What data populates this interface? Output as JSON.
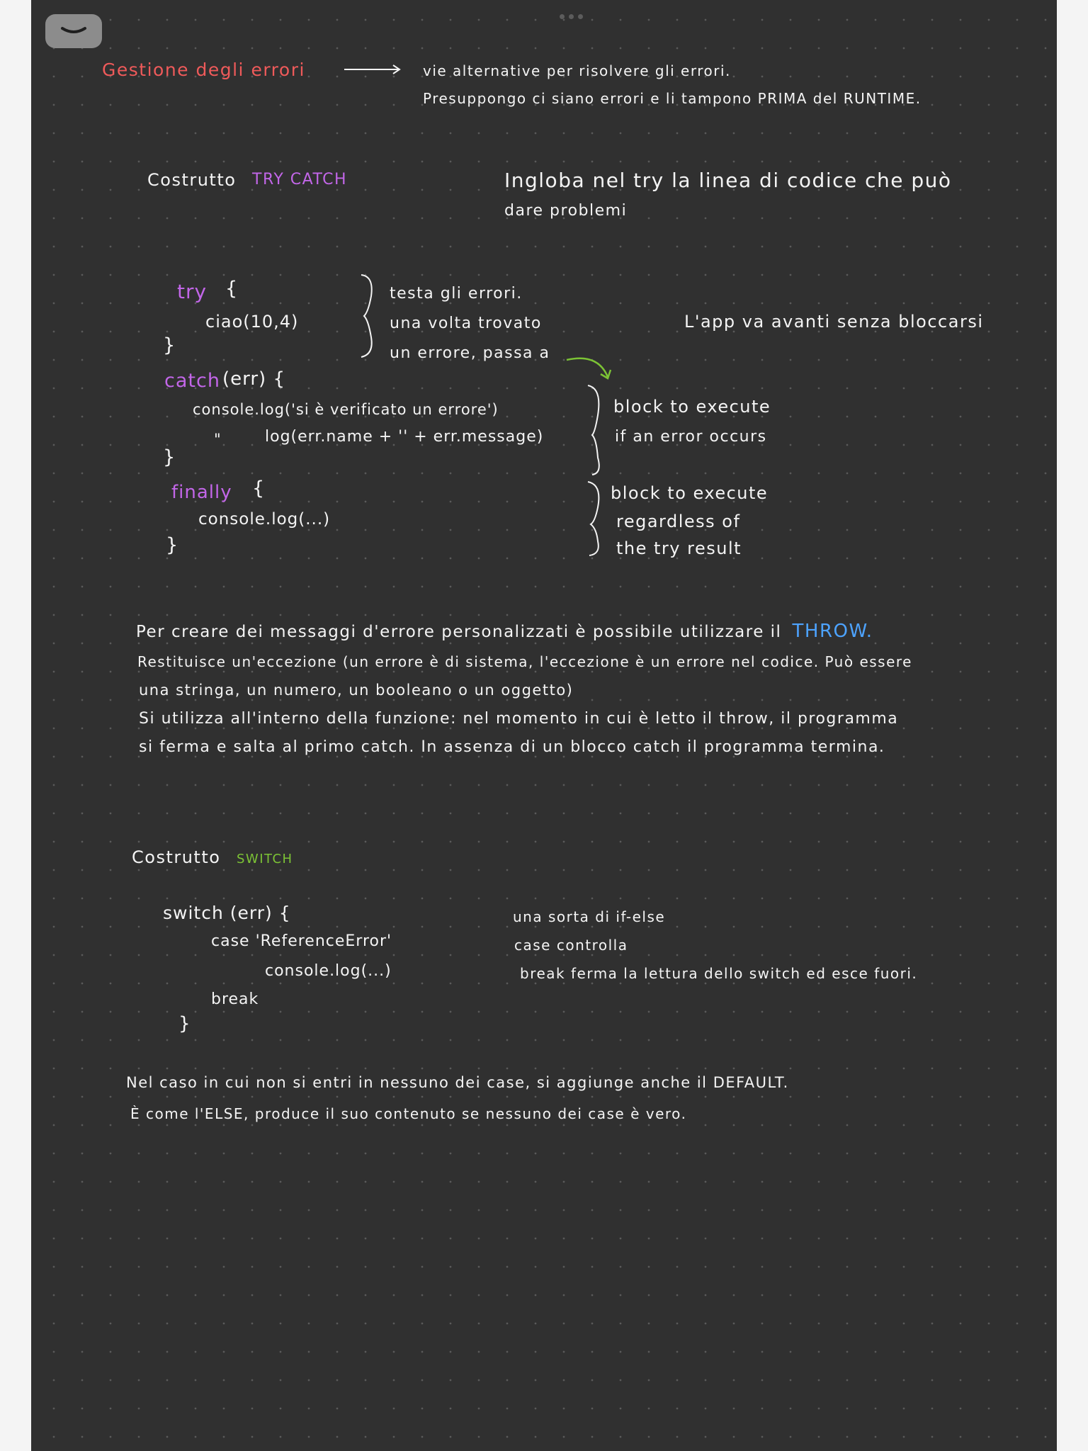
{
  "toolbar": {
    "collapse_icon": "chevron-down-icon"
  },
  "colors": {
    "red": "#ef5a5a",
    "purple": "#c266e8",
    "blue": "#4da3ff",
    "green": "#7cc335",
    "ink": "#f4f4f4",
    "paper": "#303030"
  },
  "section_errors": {
    "title": "Gestione degli errori",
    "desc_line1": "vie alternative per risolvere gli errori.",
    "desc_line2": "Presuppongo ci siano errori e li tampono PRIMA del RUNTIME."
  },
  "section_try": {
    "label": "Costrutto",
    "keyword": "TRY CATCH",
    "note_line1": "Ingloba nel try la linea di codice che può",
    "note_line2": "dare problemi",
    "code": {
      "try_kw": "try",
      "try_brace": "{",
      "try_body": "ciao(10,4)",
      "try_close": "}",
      "catch_kw": "catch",
      "catch_args": "(err) {",
      "catch_body1": "console.log('si è verificato un errore')",
      "catch_body2_prefix": "\"",
      "catch_body2": "log(err.name + '' + err.message)",
      "catch_close": "}",
      "finally_kw": "finally",
      "finally_brace": "{",
      "finally_body": "console.log(...)",
      "finally_close": "}"
    },
    "try_note": [
      "testa gli errori.",
      "una volta trovato",
      "un errore, passa a"
    ],
    "app_note": "L'app va avanti senza bloccarsi",
    "catch_note": [
      "block to execute",
      "if an error occurs"
    ],
    "finally_note": [
      "block to execute",
      "regardless of",
      "the try result"
    ]
  },
  "section_throw": {
    "line1_text": "Per creare dei messaggi d'errore personalizzati è possibile utilizzare il",
    "line1_keyword": "THROW.",
    "line2": "Restituisce un'eccezione (un errore è di sistema, l'eccezione è un errore nel codice. Può essere",
    "line3": "una stringa, un numero, un booleano o un oggetto)",
    "line4": "Si utilizza all'interno della funzione: nel momento in cui è letto il throw, il programma",
    "line5": "si ferma e salta al primo catch. In assenza di un blocco catch il programma termina."
  },
  "section_switch": {
    "label": "Costrutto",
    "keyword": "SWITCH",
    "code": {
      "line1": "switch (err) {",
      "line2": "case 'ReferenceError'",
      "line3": "console.log(...)",
      "line4": "break",
      "line5": "}"
    },
    "notes": [
      "una sorta di if-else",
      "case controlla",
      "break ferma la lettura dello switch ed esce fuori."
    ]
  },
  "section_default": {
    "line1": "Nel caso in cui non si entri in nessuno dei case, si aggiunge anche il DEFAULT.",
    "line2": "È come l'ELSE, produce il suo contenuto se nessuno dei case è vero."
  }
}
